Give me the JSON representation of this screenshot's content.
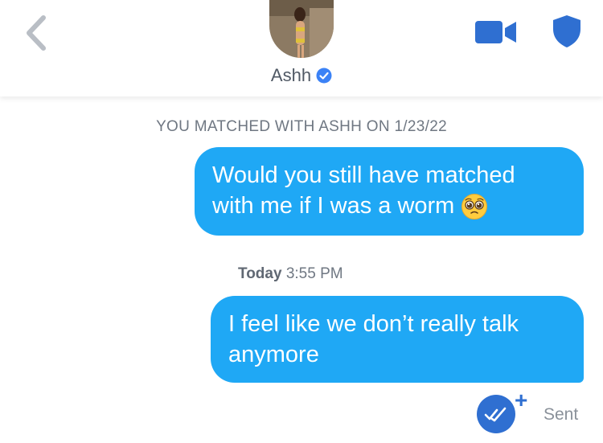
{
  "header": {
    "name": "Ashh",
    "back_icon": "chevron-left-icon",
    "verified_icon": "verified-badge-icon",
    "video_icon": "video-camera-icon",
    "shield_icon": "shield-icon"
  },
  "conversation": {
    "match_notice": "YOU MATCHED WITH ASHH ON 1/23/22",
    "messages": [
      {
        "text_line1": "Would you still have matched",
        "text_line2": "with me if I was a worm",
        "emoji": "pleading-face-emoji",
        "from": "self"
      },
      {
        "text_line1": "I feel like we don’t really talk",
        "text_line2": "anymore",
        "from": "self"
      }
    ],
    "timestamp": {
      "day": "Today",
      "time": "3:55 PM"
    },
    "receipt": {
      "plus": "+",
      "status": "Sent"
    }
  },
  "colors": {
    "bubble": "#1fa8f5",
    "accent": "#2f6fd1",
    "verified": "#3b82f6"
  }
}
